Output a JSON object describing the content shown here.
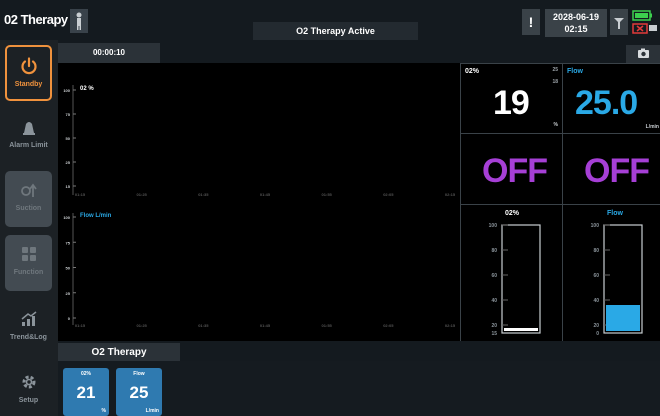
{
  "header": {
    "title": "02 Therapy",
    "status": "O2 Therapy Active",
    "date": "2028-06-19",
    "time": "02:15",
    "alert_symbol": "!"
  },
  "sidebar": {
    "items": [
      {
        "label": "Standby",
        "icon": "power-icon"
      },
      {
        "label": "Alarm Limit",
        "icon": "alarm-bell-icon"
      },
      {
        "label": "Suction",
        "icon": "suction-icon"
      },
      {
        "label": "Function",
        "icon": "grid-icon"
      },
      {
        "label": "Trend&Log",
        "icon": "trend-icon"
      },
      {
        "label": "Setup",
        "icon": "gear-icon"
      }
    ]
  },
  "graph": {
    "timer": "00:00:10",
    "o2_label": "02 %",
    "flow_label": "Flow L/min",
    "o2_y_ticks": [
      "100",
      "75",
      "50",
      "25",
      "15"
    ],
    "flow_y_ticks": [
      "100",
      "75",
      "50",
      "25",
      "0"
    ],
    "x_ticks": [
      "01:15",
      "01:25",
      "01:35",
      "01:45",
      "01:55",
      "02:05",
      "02:15"
    ]
  },
  "monitor": {
    "o2": {
      "label": "02%",
      "value": "19",
      "unit": "%",
      "high": "25",
      "low": "18"
    },
    "flow": {
      "label": "Flow",
      "value": "25.0",
      "unit": "L/min"
    },
    "o2_state": "OFF",
    "flow_state": "OFF",
    "o2_bar": {
      "label": "02%",
      "ticks": [
        "100",
        "80",
        "60",
        "40",
        "20",
        "15"
      ],
      "level": 0.02
    },
    "flow_bar": {
      "label": "Flow",
      "ticks": [
        "100",
        "80",
        "60",
        "40",
        "20",
        "0"
      ],
      "level": 0.25
    }
  },
  "bottom": {
    "tab_label": "O2 Therapy",
    "cards": [
      {
        "label": "02%",
        "value": "21",
        "unit": "%"
      },
      {
        "label": "Flow",
        "value": "25",
        "unit": "L/min"
      }
    ]
  },
  "colors": {
    "accent_orange": "#f0923d",
    "flow_cyan": "#2aa9e6",
    "off_purple": "#a63fd6",
    "battery_green": "#3ccf4e"
  }
}
